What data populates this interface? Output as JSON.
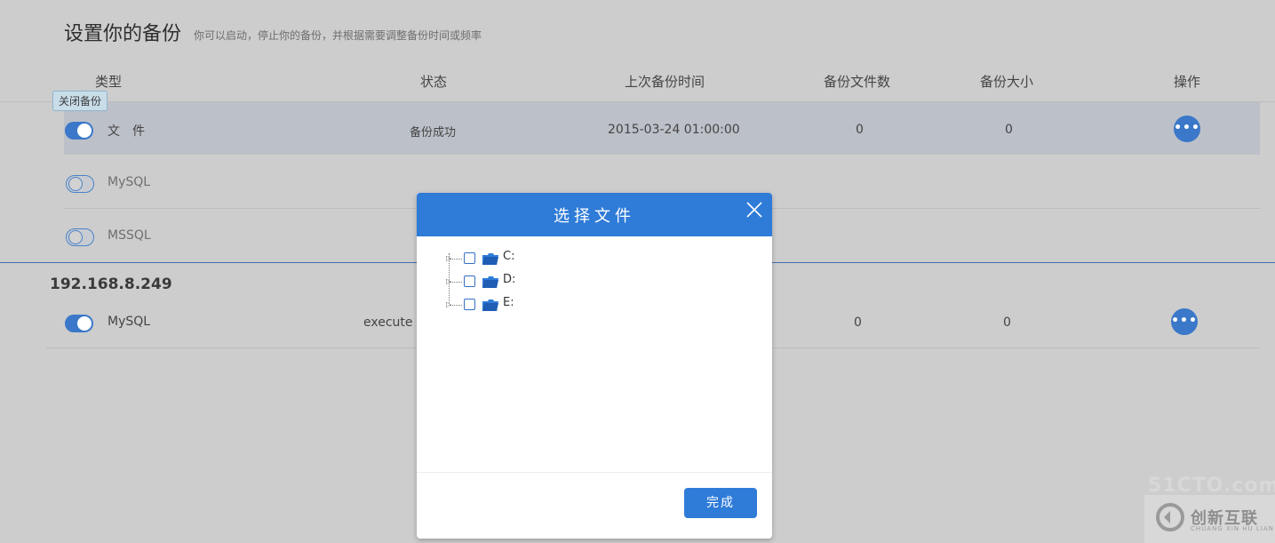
{
  "page": {
    "title": "设置你的备份",
    "subtitle": "你可以启动，停止你的备份，并根据需要调整备份时间或频率"
  },
  "columns": {
    "type": "类型",
    "status": "状态",
    "last_backup": "上次备份时间",
    "file_count": "备份文件数",
    "size": "备份大小",
    "actions": "操作"
  },
  "tooltip": "关闭备份",
  "rows": [
    {
      "type": "文　件",
      "status": "备份成功",
      "last_backup": "2015-03-24 01:00:00",
      "file_count": "0",
      "size": "0",
      "enabled": true
    },
    {
      "type": "MySQL",
      "enabled": false
    },
    {
      "type": "MSSQL",
      "enabled": false
    }
  ],
  "section2": {
    "host": "192.168.8.249",
    "rows": [
      {
        "type": "MySQL",
        "status": "execute r",
        "file_count": "0",
        "size": "0",
        "enabled": true
      }
    ]
  },
  "ops_button_label": "•••",
  "modal": {
    "title": "选择文件",
    "drives": [
      {
        "label": "C:"
      },
      {
        "label": "D:"
      },
      {
        "label": "E:"
      }
    ],
    "done_label": "完成"
  },
  "watermark": {
    "site": "51CTO.com",
    "brand_cn": "创新互联",
    "brand_en": "CHUANG XIN HU LIAN"
  },
  "colors": {
    "accent": "#2f7bd8",
    "toggle_on": "#3b78c9",
    "selected_row": "#bcc0c8"
  }
}
